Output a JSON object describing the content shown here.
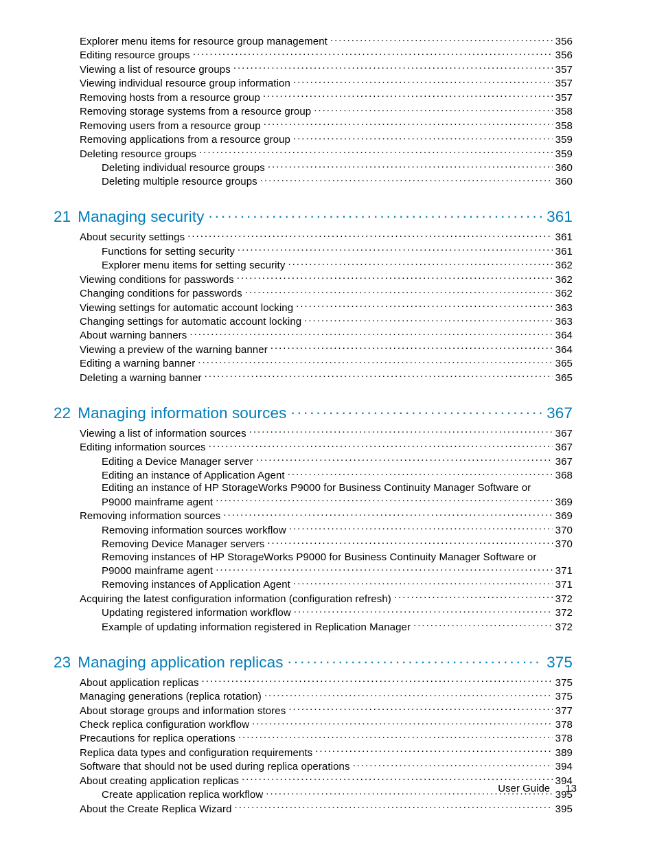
{
  "footer": {
    "label": "User Guide",
    "page": "13"
  },
  "pre": [
    {
      "indent": 1,
      "text": "Explorer menu items for resource group management",
      "page": "356"
    },
    {
      "indent": 1,
      "text": "Editing resource groups",
      "page": "356"
    },
    {
      "indent": 1,
      "text": "Viewing a list of resource groups",
      "page": "357"
    },
    {
      "indent": 1,
      "text": "Viewing individual resource group information",
      "page": "357"
    },
    {
      "indent": 1,
      "text": "Removing hosts from a resource group",
      "page": "357"
    },
    {
      "indent": 1,
      "text": "Removing storage systems from a resource group",
      "page": "358"
    },
    {
      "indent": 1,
      "text": "Removing users from a resource group",
      "page": "358"
    },
    {
      "indent": 1,
      "text": "Removing applications from a resource group",
      "page": "359"
    },
    {
      "indent": 1,
      "text": "Deleting resource groups",
      "page": "359"
    },
    {
      "indent": 2,
      "text": "Deleting individual resource groups",
      "page": "360"
    },
    {
      "indent": 2,
      "text": "Deleting multiple resource groups",
      "page": "360"
    }
  ],
  "ch21": {
    "num": "21",
    "title": "Managing security",
    "page": "361",
    "items": [
      {
        "indent": 1,
        "text": "About security settings",
        "page": "361"
      },
      {
        "indent": 2,
        "text": "Functions for setting security",
        "page": "361"
      },
      {
        "indent": 2,
        "text": "Explorer menu items for setting security",
        "page": "362"
      },
      {
        "indent": 1,
        "text": "Viewing conditions for passwords",
        "page": "362"
      },
      {
        "indent": 1,
        "text": "Changing conditions for passwords",
        "page": "362"
      },
      {
        "indent": 1,
        "text": "Viewing settings for automatic account locking",
        "page": "363"
      },
      {
        "indent": 1,
        "text": "Changing settings for automatic account locking",
        "page": "363"
      },
      {
        "indent": 1,
        "text": "About warning banners",
        "page": "364"
      },
      {
        "indent": 1,
        "text": "Viewing a preview of the warning banner",
        "page": "364"
      },
      {
        "indent": 1,
        "text": "Editing a warning banner",
        "page": "365"
      },
      {
        "indent": 1,
        "text": "Deleting a warning banner",
        "page": "365"
      }
    ]
  },
  "ch22": {
    "num": "22",
    "title": "Managing information sources",
    "page": "367",
    "items": [
      {
        "indent": 1,
        "text": "Viewing a list of information sources",
        "page": "367"
      },
      {
        "indent": 1,
        "text": "Editing information sources",
        "page": "367"
      },
      {
        "indent": 2,
        "text": "Editing a Device Manager server",
        "page": "367"
      },
      {
        "indent": 2,
        "text": "Editing an instance of Application Agent",
        "page": "368"
      },
      {
        "indent": 2,
        "wrap": true,
        "line1": "Editing an instance of HP StorageWorks P9000 for Business Continuity Manager Software or",
        "line2": "P9000 mainframe agent",
        "page": "369"
      },
      {
        "indent": 1,
        "text": "Removing information sources",
        "page": "369"
      },
      {
        "indent": 2,
        "text": "Removing information sources workflow",
        "page": "370"
      },
      {
        "indent": 2,
        "text": "Removing Device Manager servers",
        "page": "370"
      },
      {
        "indent": 2,
        "wrap": true,
        "line1": "Removing instances of HP StorageWorks P9000 for Business Continuity Manager Software or",
        "line2": "P9000 mainframe agent",
        "page": "371"
      },
      {
        "indent": 2,
        "text": "Removing instances of Application Agent",
        "page": "371"
      },
      {
        "indent": 1,
        "text": "Acquiring the latest configuration information (configuration refresh)",
        "page": "372"
      },
      {
        "indent": 2,
        "text": "Updating registered information workflow",
        "page": "372"
      },
      {
        "indent": 2,
        "text": "Example of updating information registered in Replication Manager",
        "page": "372"
      }
    ]
  },
  "ch23": {
    "num": "23",
    "title": "Managing application replicas",
    "page": "375",
    "items": [
      {
        "indent": 1,
        "text": "About application replicas",
        "page": "375"
      },
      {
        "indent": 1,
        "text": "Managing generations (replica rotation)",
        "page": "375"
      },
      {
        "indent": 1,
        "text": "About storage groups and information stores",
        "page": "377"
      },
      {
        "indent": 1,
        "text": "Check replica configuration workflow",
        "page": "378"
      },
      {
        "indent": 1,
        "text": "Precautions for replica operations",
        "page": "378"
      },
      {
        "indent": 1,
        "text": "Replica data types and configuration requirements",
        "page": "389"
      },
      {
        "indent": 1,
        "text": "Software that should not be used during replica operations",
        "page": "394"
      },
      {
        "indent": 1,
        "text": "About creating application replicas",
        "page": "394"
      },
      {
        "indent": 2,
        "text": "Create application replica workflow",
        "page": "395"
      },
      {
        "indent": 1,
        "text": "About the Create Replica Wizard",
        "page": "395"
      }
    ]
  }
}
